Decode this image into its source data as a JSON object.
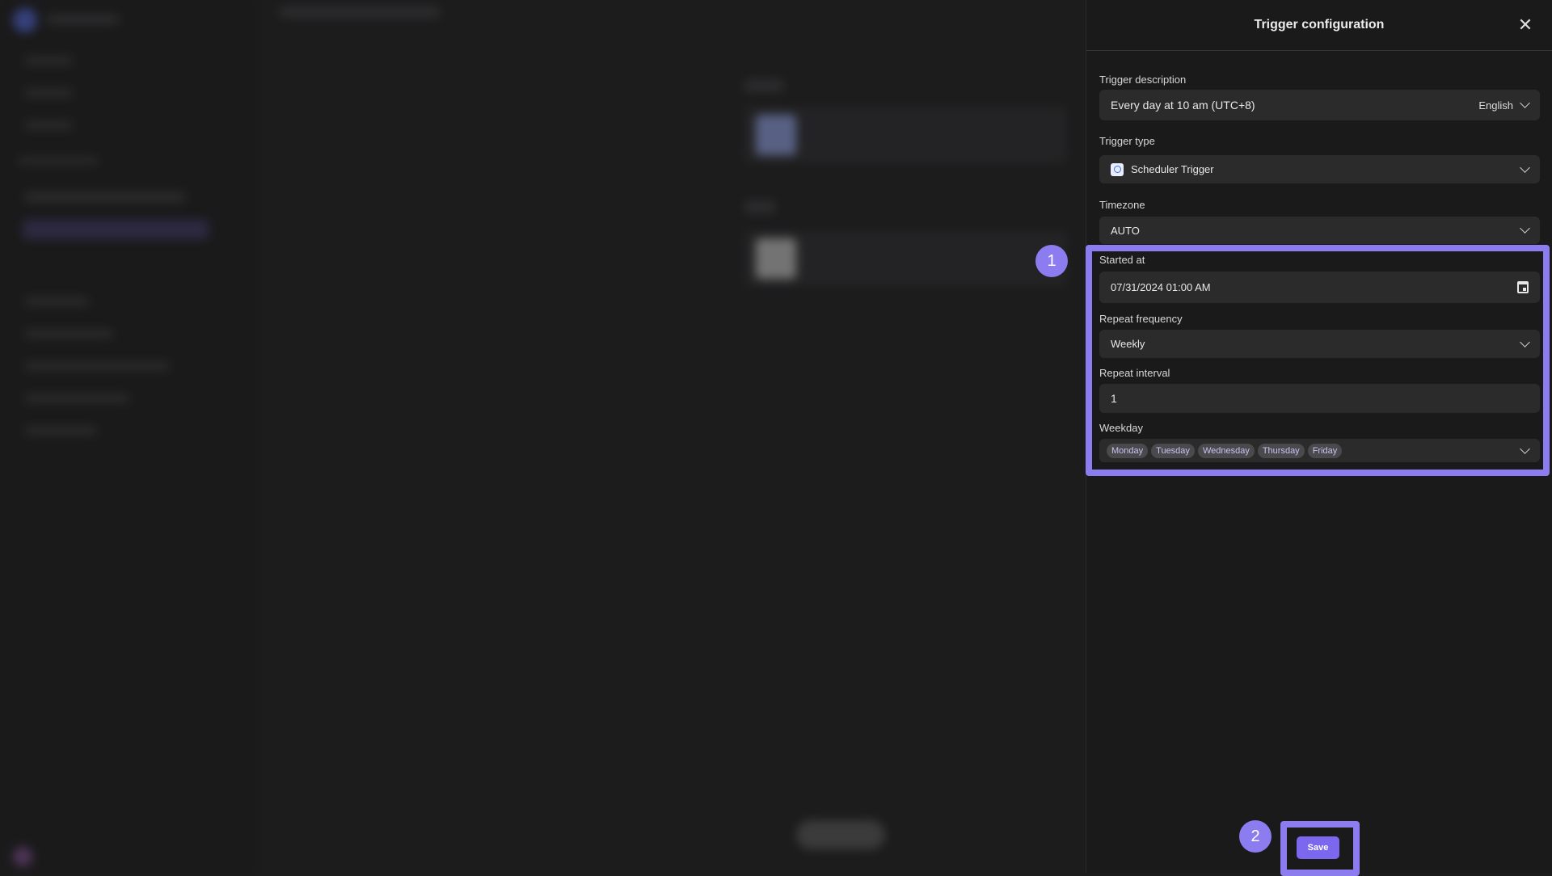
{
  "panel": {
    "title": "Trigger configuration",
    "close_icon": "close-icon",
    "trigger_description": {
      "label": "Trigger description",
      "value": "Every day at 10 am (UTC+8)",
      "language": "English"
    },
    "trigger_type": {
      "label": "Trigger type",
      "value": "Scheduler Trigger",
      "icon": "stopwatch-icon"
    },
    "timezone": {
      "label": "Timezone",
      "value": "AUTO"
    },
    "started_at": {
      "label": "Started at",
      "value": "07/31/2024 01:00 AM",
      "icon": "calendar-icon"
    },
    "repeat_frequency": {
      "label": "Repeat frequency",
      "value": "Weekly"
    },
    "repeat_interval": {
      "label": "Repeat interval",
      "value": "1"
    },
    "weekday": {
      "label": "Weekday",
      "selected": [
        "Monday",
        "Tuesday",
        "Wednesday",
        "Thursday",
        "Friday"
      ]
    },
    "save_label": "Save"
  },
  "annotations": {
    "step1": "1",
    "step2": "2",
    "highlight_color": "#8b7cf0"
  },
  "colors": {
    "accent": "#7b68ee",
    "background": "#1c1c1d"
  }
}
